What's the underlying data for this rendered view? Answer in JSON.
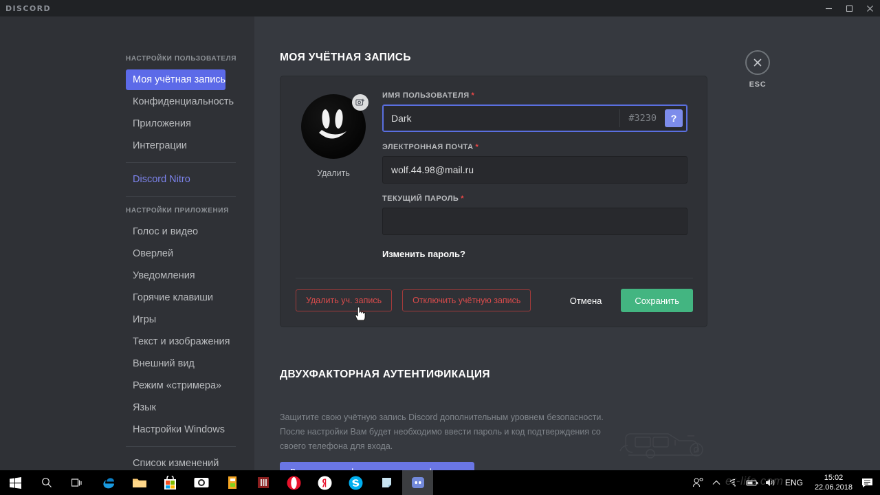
{
  "window": {
    "brand": "DISCORD",
    "minimize_icon": "minimize-icon",
    "maximize_icon": "maximize-icon",
    "close_icon": "close-icon"
  },
  "sidebar": {
    "user_settings_header": "НАСТРОЙКИ ПОЛЬЗОВАТЕЛЯ",
    "user_items": [
      {
        "label": "Моя учётная запись",
        "active": true
      },
      {
        "label": "Конфиденциальность",
        "active": false
      },
      {
        "label": "Приложения",
        "active": false
      },
      {
        "label": "Интеграции",
        "active": false
      }
    ],
    "nitro_label": "Discord Nitro",
    "app_settings_header": "НАСТРОЙКИ ПРИЛОЖЕНИЯ",
    "app_items": [
      {
        "label": "Голос и видео"
      },
      {
        "label": "Оверлей"
      },
      {
        "label": "Уведомления"
      },
      {
        "label": "Горячие клавиши"
      },
      {
        "label": "Игры"
      },
      {
        "label": "Текст и изображения"
      },
      {
        "label": "Внешний вид"
      },
      {
        "label": "Режим «стримера»"
      },
      {
        "label": "Язык"
      },
      {
        "label": "Настройки Windows"
      }
    ],
    "changelog_label": "Список изменений"
  },
  "main": {
    "page_title": "МОЯ УЧЁТНАЯ ЗАПИСЬ",
    "esc": {
      "label": "ESC",
      "icon": "close-icon"
    },
    "account": {
      "avatar_icon": "smiley-avatar",
      "avatar_upload_icon": "camera-add-icon",
      "avatar_remove_label": "Удалить",
      "username_label": "ИМЯ ПОЛЬЗОВАТЕЛЯ",
      "username_value": "Dark",
      "discriminator": "#3230",
      "help_icon": "question-mark-icon",
      "email_label": "ЭЛЕКТРОННАЯ ПОЧТА",
      "email_value": "wolf.44.98@mail.ru",
      "password_label": "ТЕКУЩИЙ ПАРОЛЬ",
      "password_value": "",
      "change_password_label": "Изменить пароль?",
      "required_mark": "*",
      "delete_account_label": "Удалить уч. запись",
      "disable_account_label": "Отключить учётную запись",
      "cancel_label": "Отмена",
      "save_label": "Сохранить"
    },
    "twofa": {
      "title": "ДВУХФАКТОРНАЯ АУТЕНТИФИКАЦИЯ",
      "description": "Защитите свою учётную запись Discord дополнительным уровнем безопасности. После настройки Вам будет необходимо ввести пароль и код подтверждения со своего телефона для входа.",
      "enable_label": "Включить двухфакторную аутентификацию",
      "illustration_icon": "van-line-art"
    }
  },
  "taskbar": {
    "icons": [
      {
        "name": "windows-start-icon"
      },
      {
        "name": "search-icon"
      },
      {
        "name": "task-view-icon"
      },
      {
        "name": "edge-browser-icon"
      },
      {
        "name": "file-explorer-icon"
      },
      {
        "name": "microsoft-store-icon"
      },
      {
        "name": "camera-app-icon"
      },
      {
        "name": "fl-studio-icon"
      },
      {
        "name": "media-app-icon"
      },
      {
        "name": "opera-browser-icon"
      },
      {
        "name": "yandex-browser-icon"
      },
      {
        "name": "skype-icon"
      },
      {
        "name": "sticky-notes-icon"
      },
      {
        "name": "discord-icon",
        "active": true
      }
    ],
    "tray": {
      "people_icon": "people-icon",
      "chevron_up_icon": "chevron-up-icon",
      "wifi_icon": "wifi-icon",
      "battery_icon": "battery-icon",
      "volume_icon": "volume-icon",
      "language": "ENG",
      "time": "15:02",
      "date": "22.06.2018",
      "notifications_icon": "notifications-icon"
    }
  },
  "watermark": {
    "text": "er-life.com"
  },
  "colors": {
    "accent_blurple": "#5c6ae8",
    "nitro": "#7c83eb",
    "danger": "#d94b4b",
    "success": "#43b581",
    "sidebar_bg": "#2f3136",
    "content_bg": "#36393f",
    "card_bg": "#2f3136"
  }
}
